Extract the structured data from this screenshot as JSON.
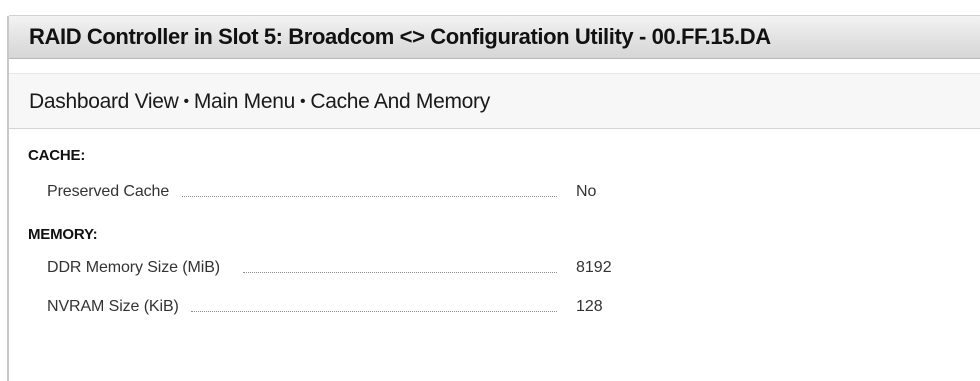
{
  "window": {
    "title": "RAID Controller in Slot 5: Broadcom <> Configuration Utility - 00.FF.15.DA"
  },
  "breadcrumb": {
    "items": [
      "Dashboard View",
      "Main Menu",
      "Cache And Memory"
    ],
    "separator": "•"
  },
  "sections": {
    "cache": {
      "header": "CACHE:",
      "fields": [
        {
          "label": "Preserved Cache",
          "value": "No"
        }
      ]
    },
    "memory": {
      "header": "MEMORY:",
      "fields": [
        {
          "label": "DDR Memory Size (MiB)",
          "value": "8192"
        },
        {
          "label": "NVRAM Size (KiB)",
          "value": "128"
        }
      ]
    }
  },
  "colors": {
    "title_bar": "#e2e2e2",
    "breadcrumb_bar": "#f7f7f7",
    "text": "#1a1a1a",
    "leader": "#8a8a8a"
  }
}
